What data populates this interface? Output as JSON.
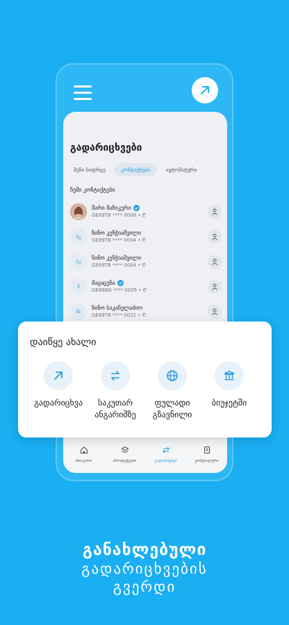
{
  "screen": {
    "title": "გადარიცხვები",
    "tabs": [
      "შენი სიფრცე",
      "კონტაქტები",
      "ავტომატური"
    ],
    "active_tab": 1,
    "section_label": "ჩემი კონტაქტები"
  },
  "contacts": [
    {
      "initials": "",
      "name": "მარი მანიკური",
      "account": "GE89TB **** 0008 • ₾",
      "verified": true,
      "photo": true
    },
    {
      "initials": "ნკ",
      "name": "ნინო კენჭიაშვილი",
      "account": "GE89TB **** 0004 • ₾",
      "verified": false,
      "photo": false
    },
    {
      "initials": "ნკ",
      "name": "ნინო კენჭიაშვილი",
      "account": "GE89TB **** 0004 • ₾",
      "verified": false,
      "photo": false
    },
    {
      "initials": "მ",
      "name": "მაცაცუნა",
      "account": "GE89BG **** 0005 • ₾",
      "verified": true,
      "photo": false
    },
    {
      "initials": "ნს",
      "name": "ნინო საკანელაძიო",
      "account": "GE89TB **** 0022 • ₾",
      "verified": false,
      "photo": false
    }
  ],
  "nav": [
    {
      "label": "მთავარი",
      "icon": "home-icon"
    },
    {
      "label": "პროდუქტები",
      "icon": "layers-icon"
    },
    {
      "label": "გადარიცხვა",
      "icon": "transfer-icon"
    },
    {
      "label": "კომუნალური",
      "icon": "bill-icon"
    }
  ],
  "card": {
    "title": "დაიწყე ახალი",
    "actions": [
      {
        "label": "გადარიცხვა",
        "icon": "arrow-up-right-icon"
      },
      {
        "label": "საკუთარ ანგარიშზე",
        "icon": "swap-icon"
      },
      {
        "label": "ფულადი გზავნილი",
        "icon": "globe-icon"
      },
      {
        "label": "ბიუჯეტში",
        "icon": "bank-icon"
      }
    ]
  },
  "headline": {
    "line1": "განახლებული",
    "line2": "გადარიცხვების",
    "line3": "გვერდი"
  },
  "colors": {
    "accent": "#1aaef2",
    "link": "#2a9ad8",
    "verified": "#2a9ad8"
  }
}
